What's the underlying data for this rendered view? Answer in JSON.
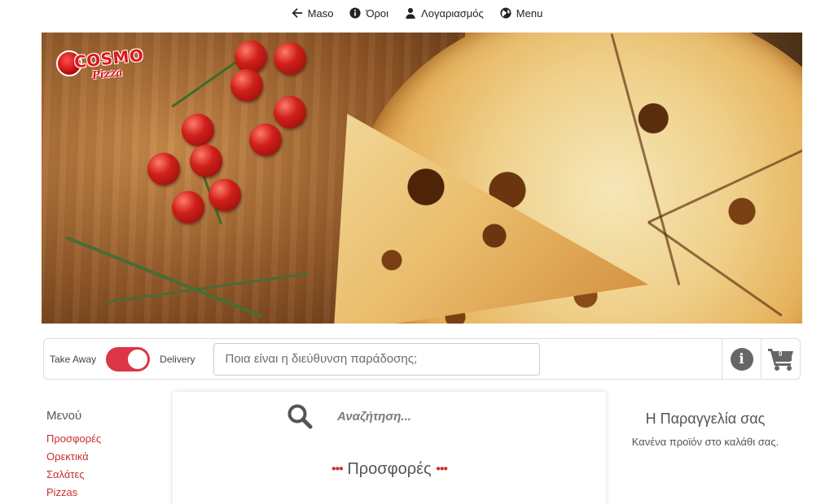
{
  "nav": {
    "items": [
      {
        "label": "Maso",
        "icon": "arrow-left-icon"
      },
      {
        "label": "Όροι",
        "icon": "info-icon"
      },
      {
        "label": "Λογαριασμός",
        "icon": "user-icon"
      },
      {
        "label": "Menu",
        "icon": "globe-icon"
      }
    ]
  },
  "hero": {
    "logo_word": "COSMO",
    "logo_sub": "Pizza",
    "image_subject": "pizza-on-wooden-board-with-tomatoes-and-rosemary"
  },
  "order_bar": {
    "take_away_label": "Take Away",
    "delivery_label": "Delivery",
    "delivery_selected": true,
    "address_placeholder": "Ποια είναι η διεύθυνση παράδοσης;",
    "address_value": "",
    "info_icon": "info-circle-icon",
    "cart_icon": "cart-icon",
    "cart_count": "0"
  },
  "menu": {
    "title": "Μενού",
    "items": [
      "Προσφορές",
      "Ορεκτικά",
      "Σαλάτες",
      "Pizzas"
    ]
  },
  "products": {
    "search_placeholder": "Αναζήτηση...",
    "section_title": "Προσφορές",
    "section_decoration": "•••"
  },
  "order": {
    "title": "Η Παραγγελία σας",
    "empty_text": "Κανένα προϊόν στο καλάθι σας."
  },
  "colors": {
    "accent": "#dc3545",
    "link": "#c9302c",
    "icon_gray": "#666666"
  }
}
